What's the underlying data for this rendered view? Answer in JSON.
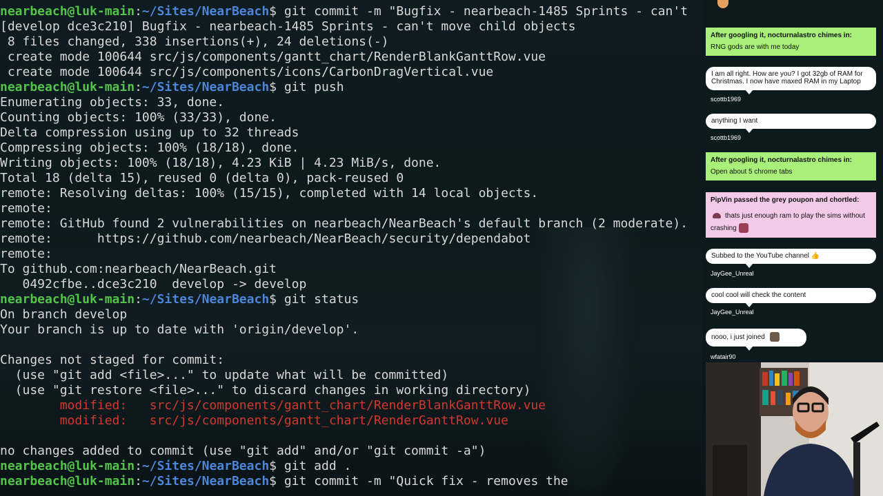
{
  "terminal": {
    "prompt": {
      "user": "nearbeach@luk-main",
      "path": "~/Sites/NearBeach",
      "dollar": "$"
    },
    "lines": [
      {
        "type": "cmd",
        "text": " git commit -m \"Bugfix - nearbeach-1485 Sprints - can't"
      },
      {
        "type": "out",
        "text": "[develop dce3c210] Bugfix - nearbeach-1485 Sprints - can't move child objects"
      },
      {
        "type": "out",
        "text": " 8 files changed, 338 insertions(+), 24 deletions(-)"
      },
      {
        "type": "out",
        "text": " create mode 100644 src/js/components/gantt_chart/RenderBlankGanttRow.vue"
      },
      {
        "type": "out",
        "text": " create mode 100644 src/js/components/icons/CarbonDragVertical.vue"
      },
      {
        "type": "cmd",
        "text": " git push"
      },
      {
        "type": "out",
        "text": "Enumerating objects: 33, done."
      },
      {
        "type": "out",
        "text": "Counting objects: 100% (33/33), done."
      },
      {
        "type": "out",
        "text": "Delta compression using up to 32 threads"
      },
      {
        "type": "out",
        "text": "Compressing objects: 100% (18/18), done."
      },
      {
        "type": "out",
        "text": "Writing objects: 100% (18/18), 4.23 KiB | 4.23 MiB/s, done."
      },
      {
        "type": "out",
        "text": "Total 18 (delta 15), reused 0 (delta 0), pack-reused 0"
      },
      {
        "type": "out",
        "text": "remote: Resolving deltas: 100% (15/15), completed with 14 local objects."
      },
      {
        "type": "out",
        "text": "remote:"
      },
      {
        "type": "out",
        "text": "remote: GitHub found 2 vulnerabilities on nearbeach/NearBeach's default branch (2 moderate)."
      },
      {
        "type": "out",
        "text": "remote:      https://github.com/nearbeach/NearBeach/security/dependabot"
      },
      {
        "type": "out",
        "text": "remote:"
      },
      {
        "type": "out",
        "text": "To github.com:nearbeach/NearBeach.git"
      },
      {
        "type": "out",
        "text": "   0492cfbe..dce3c210  develop -> develop"
      },
      {
        "type": "cmd",
        "text": " git status"
      },
      {
        "type": "out",
        "text": "On branch develop"
      },
      {
        "type": "out",
        "text": "Your branch is up to date with 'origin/develop'."
      },
      {
        "type": "out",
        "text": ""
      },
      {
        "type": "out",
        "text": "Changes not staged for commit:"
      },
      {
        "type": "out",
        "text": "  (use \"git add <file>...\" to update what will be committed)"
      },
      {
        "type": "out",
        "text": "  (use \"git restore <file>...\" to discard changes in working directory)"
      },
      {
        "type": "mod",
        "text": "        modified:   src/js/components/gantt_chart/RenderBlankGanttRow.vue"
      },
      {
        "type": "mod",
        "text": "        modified:   src/js/components/gantt_chart/RenderGanttRow.vue"
      },
      {
        "type": "out",
        "text": ""
      },
      {
        "type": "out",
        "text": "no changes added to commit (use \"git add\" and/or \"git commit -a\")"
      },
      {
        "type": "cmd",
        "text": " git add ."
      },
      {
        "type": "cmd",
        "text": " git commit -m \"Quick fix - removes the"
      }
    ]
  },
  "chat": {
    "green1": {
      "header": "After googling it, nocturnalastro chimes in:",
      "body": "RNG gods are with me today"
    },
    "msg1": {
      "text": "I am all right. How are you? I got 32gb of RAM for Christmas. I now have maxed RAM in my Laptop",
      "author": "scottb1969"
    },
    "msg2": {
      "text": "anything I want",
      "author": "scottb1969"
    },
    "green2": {
      "header": "After googling it, nocturnalastro chimes in:",
      "body": "Open about 5 chrome tabs"
    },
    "pink1": {
      "header": "PipVin passed the grey poupon and chortled:",
      "body": "thats just enough ram to play the sims without crashing"
    },
    "msg3": {
      "text": "Subbed to the YouTube channel 👍",
      "author": "JayGee_Unreal"
    },
    "msg4": {
      "text": "cool cool will check the content",
      "author": "JayGee_Unreal"
    },
    "msg5": {
      "text": "nooo, i just joined",
      "author": "wfatair90"
    }
  },
  "colors": {
    "prompt_user": "#54c34a",
    "prompt_path": "#4d86d8",
    "modified": "#d2382d",
    "chat_green": "#a8f07a",
    "chat_pink": "#f3cbe9"
  },
  "icons": [
    "emoji-thumbs-up",
    "emoji-avatar-pipvin",
    "emoji-avatar-wfatair90"
  ]
}
